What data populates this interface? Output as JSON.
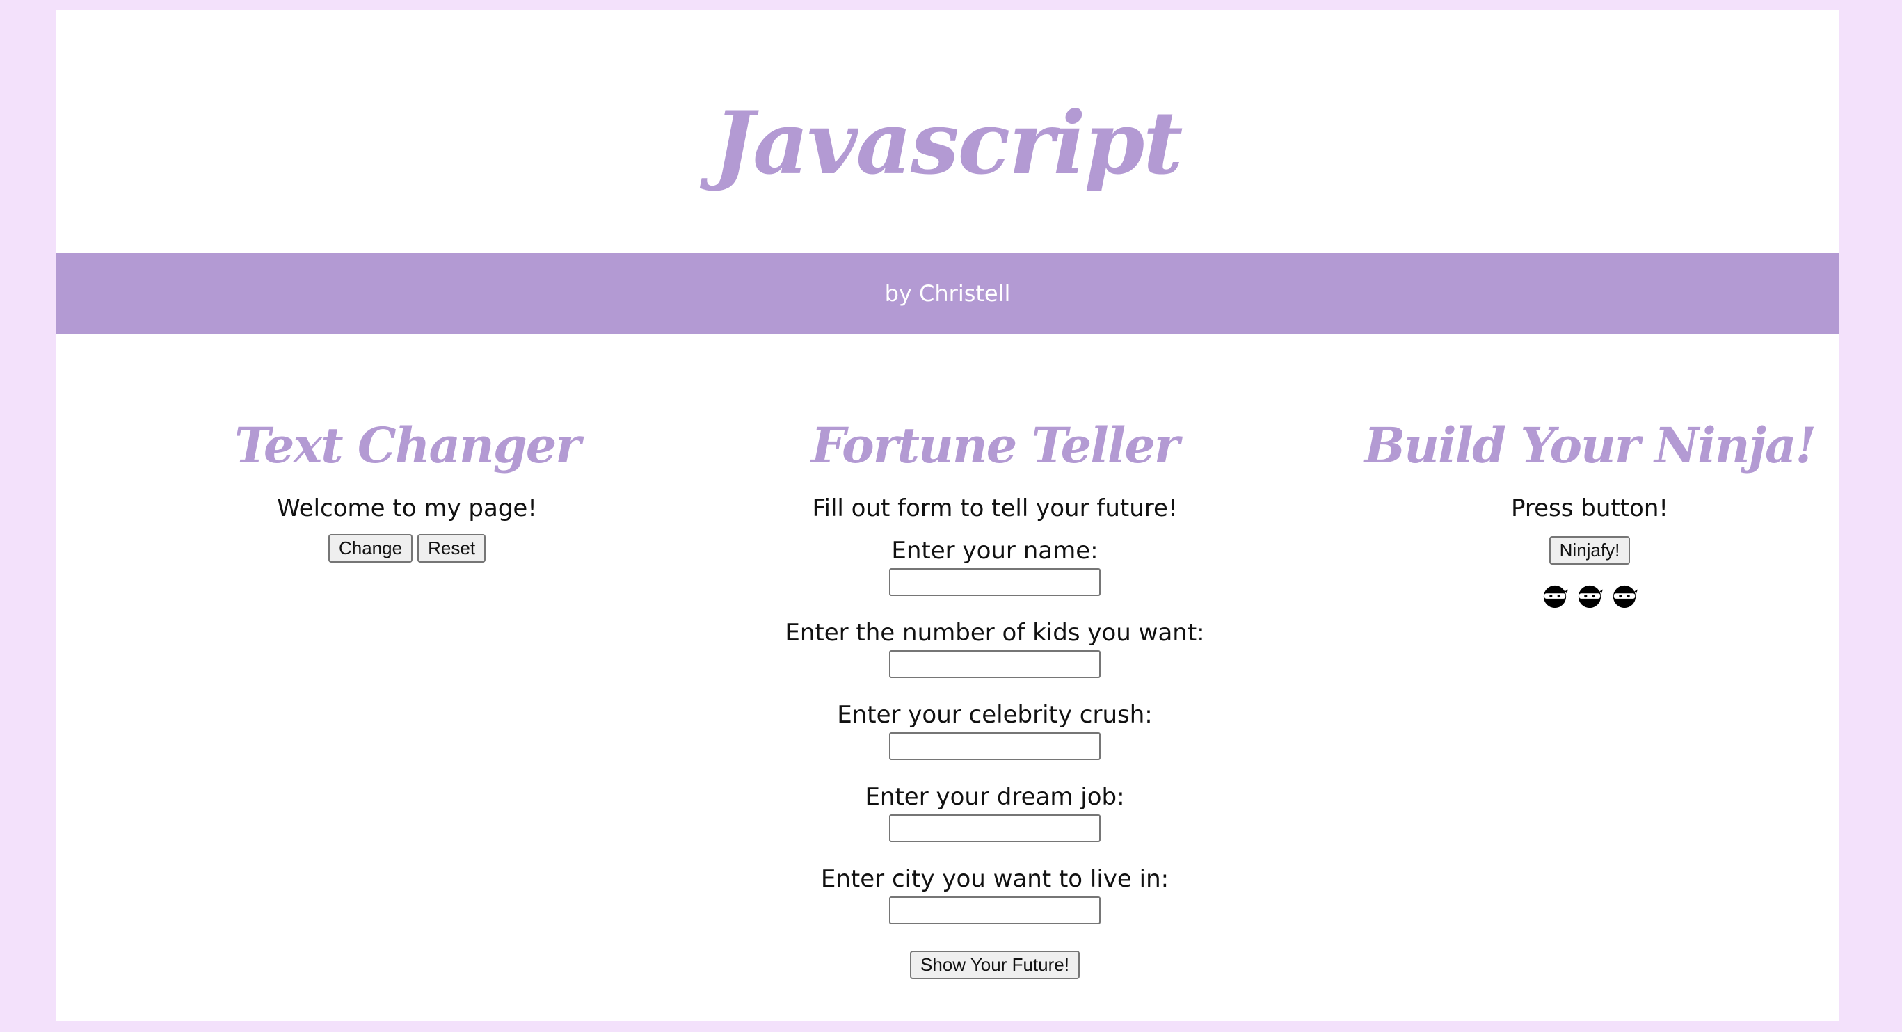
{
  "header": {
    "title": "Javascript",
    "byline": "by Christell"
  },
  "text_changer": {
    "title": "Text Changer",
    "text": "Welcome to my page!",
    "change_label": "Change",
    "reset_label": "Reset"
  },
  "fortune_teller": {
    "title": "Fortune Teller",
    "intro": "Fill out form to tell your future!",
    "fields": [
      {
        "label": "Enter your name:",
        "value": ""
      },
      {
        "label": "Enter the number of kids you want:",
        "value": ""
      },
      {
        "label": "Enter your celebrity crush:",
        "value": ""
      },
      {
        "label": "Enter your dream job:",
        "value": ""
      },
      {
        "label": "Enter city you want to live in:",
        "value": ""
      }
    ],
    "submit_label": "Show Your Future!"
  },
  "ninja": {
    "title": "Build Your Ninja!",
    "text": "Press button!",
    "button_label": "Ninjafy!",
    "icons": [
      "ninja-icon",
      "ninja-icon",
      "ninja-icon"
    ]
  },
  "colors": {
    "accent": "#b39ad3",
    "background": "#f3e1fb",
    "panel": "#ffffff"
  }
}
